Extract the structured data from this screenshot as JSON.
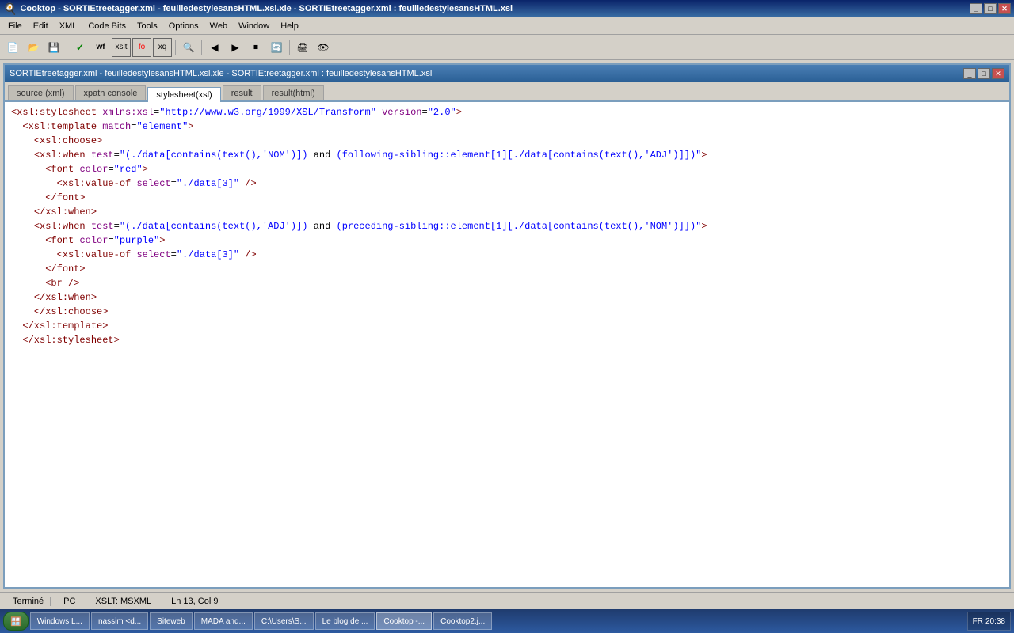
{
  "title_bar": {
    "title": "Cooktop - SORTIEtreetagger.xml - feuilledestylesansHTML.xsl.xle - SORTIEtreetagger.xml : feuilledestylesansHTML.xsl",
    "min_label": "_",
    "max_label": "□",
    "close_label": "✕"
  },
  "menu": {
    "items": [
      "File",
      "Edit",
      "XML",
      "Code Bits",
      "Tools",
      "Options",
      "Web",
      "Window",
      "Help"
    ]
  },
  "window": {
    "title": "SORTIEtreetagger.xml - feuilledestylesansHTML.xsl.xle - SORTIEtreetagger.xml : feuilledestylesansHTML.xsl",
    "min_label": "_",
    "max_label": "□",
    "close_label": "✕"
  },
  "tabs": [
    {
      "id": "source",
      "label": "source (xml)"
    },
    {
      "id": "xpath",
      "label": "xpath console"
    },
    {
      "id": "stylesheet",
      "label": "stylesheet(xsl)",
      "active": true
    },
    {
      "id": "result",
      "label": "result"
    },
    {
      "id": "result_html",
      "label": "result(html)"
    }
  ],
  "code_lines": [
    {
      "indent": 2,
      "content": "<xsl:stylesheet xmlns:xsl=\"http://www.w3.org/1999/XSL/Transform\" version=\"2.0\">"
    },
    {
      "indent": 4,
      "content": "<xsl:template match=\"element\">"
    },
    {
      "indent": 6,
      "content": "<xsl:choose>"
    },
    {
      "indent": 8,
      "content": "<xsl:when test=\"(./data[contains(text(),'NOM')]) and (following-sibling::element[1][./data[contains(text(),'ADJ')]])\">"
    },
    {
      "indent": 10,
      "content": "<font color=\"red\">"
    },
    {
      "indent": 12,
      "content": "<xsl:value-of select=\"./data[3]\" />"
    },
    {
      "indent": 10,
      "content": "</font>"
    },
    {
      "indent": 8,
      "content": "</xsl:when>"
    },
    {
      "indent": 8,
      "content": "<xsl:when test=\"(./data[contains(text(),'ADJ')]) and (preceding-sibling::element[1][./data[contains(text(),'NOM')]])\">"
    },
    {
      "indent": 10,
      "content": "<font color=\"purple\">"
    },
    {
      "indent": 12,
      "content": "<xsl:value-of select=\"./data[3]\" />"
    },
    {
      "indent": 10,
      "content": "</font>"
    },
    {
      "indent": 10,
      "content": "<br />"
    },
    {
      "indent": 8,
      "content": "</xsl:when>"
    },
    {
      "indent": 6,
      "content": "</xsl:choose>"
    },
    {
      "indent": 4,
      "content": "</xsl:template>"
    },
    {
      "indent": 2,
      "content": "</xsl:stylesheet>"
    }
  ],
  "status": {
    "status_text": "Terminé",
    "pc": "PC",
    "xslt": "XSLT: MSXML",
    "position": "Ln 13, Col 9"
  },
  "taskbar": {
    "start_label": "Start",
    "items": [
      {
        "label": "Windows L...",
        "active": false
      },
      {
        "label": "nassim <d...",
        "active": false
      },
      {
        "label": "Siteweb",
        "active": false
      },
      {
        "label": "MADA and...",
        "active": false
      },
      {
        "label": "C:\\Users\\S...",
        "active": false
      },
      {
        "label": "Le blog de ...",
        "active": false
      },
      {
        "label": "Cooktop -...",
        "active": true
      },
      {
        "label": "Cooktop2.j...",
        "active": false
      }
    ],
    "lang": "FR",
    "time": "20:38"
  }
}
